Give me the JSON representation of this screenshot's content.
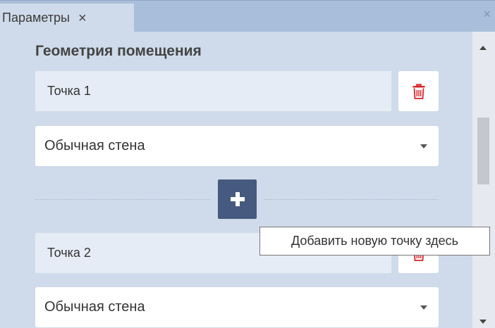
{
  "tab": {
    "label": "Параметры",
    "close_glyph": "×"
  },
  "panel": {
    "close_glyph": "×"
  },
  "section": {
    "title": "Геометрия помещения"
  },
  "points": [
    {
      "name": "Точка 1",
      "wall_type": "Обычная стена"
    },
    {
      "name": "Точка 2",
      "wall_type": "Обычная стена"
    }
  ],
  "add_point": {
    "tooltip": "Добавить новую точку здесь"
  },
  "icons": {
    "delete": "trash-icon",
    "add": "plus-icon",
    "dropdown": "chevron-down-icon"
  },
  "colors": {
    "panel_bg": "#cfdbea",
    "tab_strip": "#a8bedb",
    "accent_button": "#46597f",
    "delete_icon": "#d9262c"
  }
}
